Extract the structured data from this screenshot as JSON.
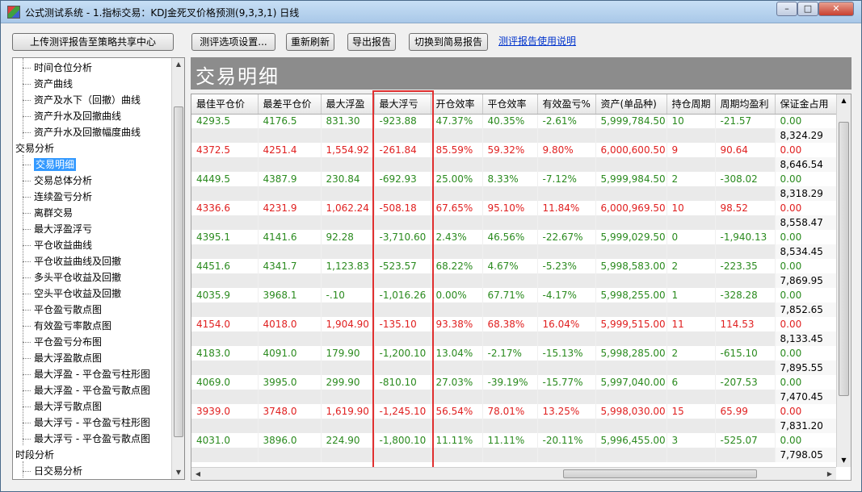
{
  "window": {
    "title": "公式测试系统 - 1.指标交易：KDJ金死叉价格预测(9,3,3,1) 日线",
    "minimize": "–",
    "maximize": "□",
    "close": "✕"
  },
  "toolbar": {
    "upload": "上传测评报告至策略共享中心",
    "options": "测评选项设置...",
    "refresh": "重新刷新",
    "export": "导出报告",
    "switch": "切换到简易报告",
    "help_link": "测评报告使用说明"
  },
  "tree": {
    "items": [
      {
        "label": "时间仓位分析",
        "level": 1
      },
      {
        "label": "资产曲线",
        "level": 1
      },
      {
        "label": "资产及水下（回撤）曲线",
        "level": 1
      },
      {
        "label": "资产升水及回撤曲线",
        "level": 1
      },
      {
        "label": "资产升水及回撤幅度曲线",
        "level": 1
      },
      {
        "label": "交易分析",
        "level": 0
      },
      {
        "label": "交易明细",
        "level": 1,
        "selected": true
      },
      {
        "label": "交易总体分析",
        "level": 1
      },
      {
        "label": "连续盈亏分析",
        "level": 1
      },
      {
        "label": "离群交易",
        "level": 1
      },
      {
        "label": "最大浮盈浮亏",
        "level": 1
      },
      {
        "label": "平仓收益曲线",
        "level": 1
      },
      {
        "label": "平仓收益曲线及回撤",
        "level": 1
      },
      {
        "label": "多头平仓收益及回撤",
        "level": 1
      },
      {
        "label": "空头平仓收益及回撤",
        "level": 1
      },
      {
        "label": "平仓盈亏散点图",
        "level": 1
      },
      {
        "label": "有效盈亏率散点图",
        "level": 1
      },
      {
        "label": "平仓盈亏分布图",
        "level": 1
      },
      {
        "label": "最大浮盈散点图",
        "level": 1
      },
      {
        "label": "最大浮盈 - 平仓盈亏柱形图",
        "level": 1
      },
      {
        "label": "最大浮盈 - 平仓盈亏散点图",
        "level": 1
      },
      {
        "label": "最大浮亏散点图",
        "level": 1
      },
      {
        "label": "最大浮亏 - 平仓盈亏柱形图",
        "level": 1
      },
      {
        "label": "最大浮亏 - 平仓盈亏散点图",
        "level": 1
      },
      {
        "label": "时段分析",
        "level": 0
      },
      {
        "label": "日交易分析",
        "level": 1
      }
    ]
  },
  "panel": {
    "title": "交易明细"
  },
  "grid": {
    "columns": [
      "最佳平仓价",
      "最差平仓价",
      "最大浮盈",
      "最大浮亏",
      "开仓效率",
      "平仓效率",
      "有效盈亏%",
      "资产(单品种)",
      "持仓周期",
      "周期均盈利",
      "保证金占用"
    ],
    "rows": [
      {
        "color": "green",
        "cells": [
          "4293.5",
          "4176.5",
          "831.30",
          "-923.88",
          "47.37%",
          "40.35%",
          "-2.61%",
          "5,999,784.50",
          "10",
          "-21.57",
          "0.00"
        ],
        "balance": "8,324.29"
      },
      {
        "color": "red",
        "cells": [
          "4372.5",
          "4251.4",
          "1,554.92",
          "-261.84",
          "85.59%",
          "59.32%",
          "9.80%",
          "6,000,600.50",
          "9",
          "90.64",
          "0.00"
        ],
        "balance": "8,646.54"
      },
      {
        "color": "green",
        "cells": [
          "4449.5",
          "4387.9",
          "230.84",
          "-692.93",
          "25.00%",
          "8.33%",
          "-7.12%",
          "5,999,984.50",
          "2",
          "-308.02",
          "0.00"
        ],
        "balance": "8,318.29"
      },
      {
        "color": "red",
        "cells": [
          "4336.6",
          "4231.9",
          "1,062.24",
          "-508.18",
          "67.65%",
          "95.10%",
          "11.84%",
          "6,000,969.50",
          "10",
          "98.52",
          "0.00"
        ],
        "balance": "8,558.47"
      },
      {
        "color": "green",
        "cells": [
          "4395.1",
          "4141.6",
          "92.28",
          "-3,710.60",
          "2.43%",
          "46.56%",
          "-22.67%",
          "5,999,029.50",
          "0",
          "-1,940.13",
          "0.00"
        ],
        "balance": "8,534.45"
      },
      {
        "color": "green",
        "cells": [
          "4451.6",
          "4341.7",
          "1,123.83",
          "-523.57",
          "68.22%",
          "4.67%",
          "-5.23%",
          "5,998,583.00",
          "2",
          "-223.35",
          "0.00"
        ],
        "balance": "7,869.95"
      },
      {
        "color": "green",
        "cells": [
          "4035.9",
          "3968.1",
          "-.10",
          "-1,016.26",
          "0.00%",
          "67.71%",
          "-4.17%",
          "5,998,255.00",
          "1",
          "-328.28",
          "0.00"
        ],
        "balance": "7,852.65"
      },
      {
        "color": "red",
        "cells": [
          "4154.0",
          "4018.0",
          "1,904.90",
          "-135.10",
          "93.38%",
          "68.38%",
          "16.04%",
          "5,999,515.00",
          "11",
          "114.53",
          "0.00"
        ],
        "balance": "8,133.45"
      },
      {
        "color": "green",
        "cells": [
          "4183.0",
          "4091.0",
          "179.90",
          "-1,200.10",
          "13.04%",
          "-2.17%",
          "-15.13%",
          "5,998,285.00",
          "2",
          "-615.10",
          "0.00"
        ],
        "balance": "7,895.55"
      },
      {
        "color": "green",
        "cells": [
          "4069.0",
          "3995.0",
          "299.90",
          "-810.10",
          "27.03%",
          "-39.19%",
          "-15.77%",
          "5,997,040.00",
          "6",
          "-207.53",
          "0.00"
        ],
        "balance": "7,470.45"
      },
      {
        "color": "red",
        "cells": [
          "3939.0",
          "3748.0",
          "1,619.90",
          "-1,245.10",
          "56.54%",
          "78.01%",
          "13.25%",
          "5,998,030.00",
          "15",
          "65.99",
          "0.00"
        ],
        "balance": "7,831.20"
      },
      {
        "color": "green",
        "cells": [
          "4031.0",
          "3896.0",
          "224.90",
          "-1,800.10",
          "11.11%",
          "11.11%",
          "-20.11%",
          "5,996,455.00",
          "3",
          "-525.07",
          "0.00"
        ],
        "balance": "7,798.05"
      }
    ]
  }
}
